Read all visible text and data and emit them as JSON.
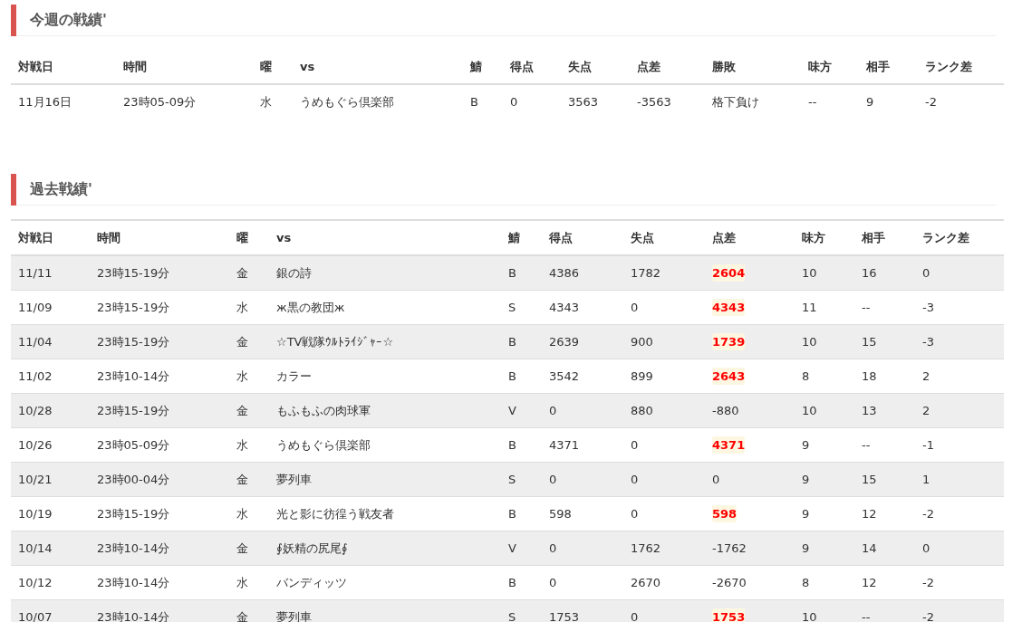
{
  "this_week": {
    "title": "今週の戦績'",
    "columns": [
      "対戦日",
      "時間",
      "曜",
      "vs",
      "鯖",
      "得点",
      "失点",
      "点差",
      "勝敗",
      "味方",
      "相手",
      "ランク差"
    ],
    "rows": [
      {
        "cells": [
          "11月16日",
          "23時05-09分",
          "水",
          "うめもぐら倶楽部",
          "B",
          "0",
          "3563",
          "-3563",
          "格下負け",
          "--",
          "9",
          "-2"
        ],
        "highlight": false
      }
    ]
  },
  "past": {
    "title": "過去戦績'",
    "columns": [
      "対戦日",
      "時間",
      "曜",
      "vs",
      "鯖",
      "得点",
      "失点",
      "点差",
      "味方",
      "相手",
      "ランク差"
    ],
    "rows": [
      {
        "cells": [
          "11/11",
          "23時15-19分",
          "金",
          "銀の詩",
          "B",
          "4386",
          "1782",
          "2604",
          "10",
          "16",
          "0"
        ],
        "highlight": true
      },
      {
        "cells": [
          "11/09",
          "23時15-19分",
          "水",
          "ж黒の教団ж",
          "S",
          "4343",
          "0",
          "4343",
          "11",
          "--",
          "-3"
        ],
        "highlight": true
      },
      {
        "cells": [
          "11/04",
          "23時15-19分",
          "金",
          "☆TV戦隊ｳﾙﾄﾗｲｼﾞｬｰ☆",
          "B",
          "2639",
          "900",
          "1739",
          "10",
          "15",
          "-3"
        ],
        "highlight": true
      },
      {
        "cells": [
          "11/02",
          "23時10-14分",
          "水",
          "カラー",
          "B",
          "3542",
          "899",
          "2643",
          "8",
          "18",
          "2"
        ],
        "highlight": true
      },
      {
        "cells": [
          "10/28",
          "23時15-19分",
          "金",
          "もふもふの肉球軍",
          "V",
          "0",
          "880",
          "-880",
          "10",
          "13",
          "2"
        ],
        "highlight": false
      },
      {
        "cells": [
          "10/26",
          "23時05-09分",
          "水",
          "うめもぐら倶楽部",
          "B",
          "4371",
          "0",
          "4371",
          "9",
          "--",
          "-1"
        ],
        "highlight": true
      },
      {
        "cells": [
          "10/21",
          "23時00-04分",
          "金",
          "夢列車",
          "S",
          "0",
          "0",
          "0",
          "9",
          "15",
          "1"
        ],
        "highlight": false
      },
      {
        "cells": [
          "10/19",
          "23時15-19分",
          "水",
          "光と影に彷徨う戦友者",
          "B",
          "598",
          "0",
          "598",
          "9",
          "12",
          "-2"
        ],
        "highlight": true
      },
      {
        "cells": [
          "10/14",
          "23時10-14分",
          "金",
          "∮妖精の尻尾∮",
          "V",
          "0",
          "1762",
          "-1762",
          "9",
          "14",
          "0"
        ],
        "highlight": false
      },
      {
        "cells": [
          "10/12",
          "23時10-14分",
          "水",
          "バンディッツ",
          "B",
          "0",
          "2670",
          "-2670",
          "8",
          "12",
          "-2"
        ],
        "highlight": false
      },
      {
        "cells": [
          "10/07",
          "23時10-14分",
          "金",
          "夢列車",
          "S",
          "1753",
          "0",
          "1753",
          "10",
          "--",
          "-2"
        ],
        "highlight": true
      }
    ]
  }
}
